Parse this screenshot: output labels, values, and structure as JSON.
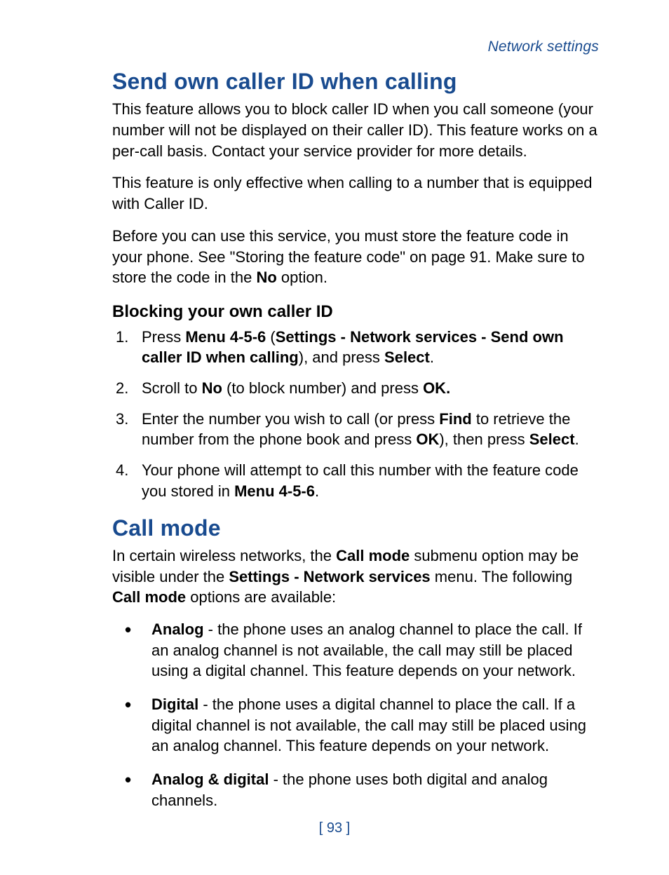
{
  "header": {
    "label": "Network settings"
  },
  "section1": {
    "title": "Send own caller ID when calling",
    "p1": "This feature allows you to block caller ID when you call someone (your number will not be displayed on their caller ID). This feature works on a per-call basis. Contact your service provider for more details.",
    "p2": "This feature is only effective when calling to a number that is equipped with Caller ID.",
    "p3_a": "Before you can use this service, you must store the feature code in your phone. See \"Storing the feature code\" on page 91. Make sure to store the code in the ",
    "p3_b": "No",
    "p3_c": " option.",
    "sub1": {
      "title": "Blocking your own caller ID",
      "steps": {
        "s1_a": "Press ",
        "s1_b": "Menu 4-5-6",
        "s1_c": " (",
        "s1_d": "Settings - Network services - Send own caller ID when calling",
        "s1_e": "), and press ",
        "s1_f": "Select",
        "s1_g": ".",
        "s2_a": "Scroll to ",
        "s2_b": "No",
        "s2_c": " (to block number) and press ",
        "s2_d": "OK.",
        "s3_a": "Enter the number you wish to call (or press ",
        "s3_b": "Find",
        "s3_c": " to retrieve the number from the phone book and press ",
        "s3_d": "OK",
        "s3_e": "), then press ",
        "s3_f": "Select",
        "s3_g": ".",
        "s4_a": "Your phone will attempt to call this number with the feature code you stored in ",
        "s4_b": "Menu 4-5-6",
        "s4_c": "."
      }
    }
  },
  "section2": {
    "title": "Call mode",
    "p1_a": "In certain wireless networks, the ",
    "p1_b": "Call mode",
    "p1_c": " submenu option may be visible under the ",
    "p1_d": "Settings - Network services",
    "p1_e": " menu. The following ",
    "p1_f": "Call mode",
    "p1_g": " options are available:",
    "bullets": {
      "b1_a": "Analog",
      "b1_b": " - the phone uses an analog channel to place the call. If an analog channel is not available, the call may still be placed using a digital channel. This feature depends on your network.",
      "b2_a": "Digital",
      "b2_b": " - the phone uses a digital channel to place the call. If a digital channel is not available, the call may still be placed using an analog channel. This feature depends on your network.",
      "b3_a": "Analog & digital",
      "b3_b": " - the phone uses both digital and analog channels."
    }
  },
  "pagenum": "[ 93 ]"
}
